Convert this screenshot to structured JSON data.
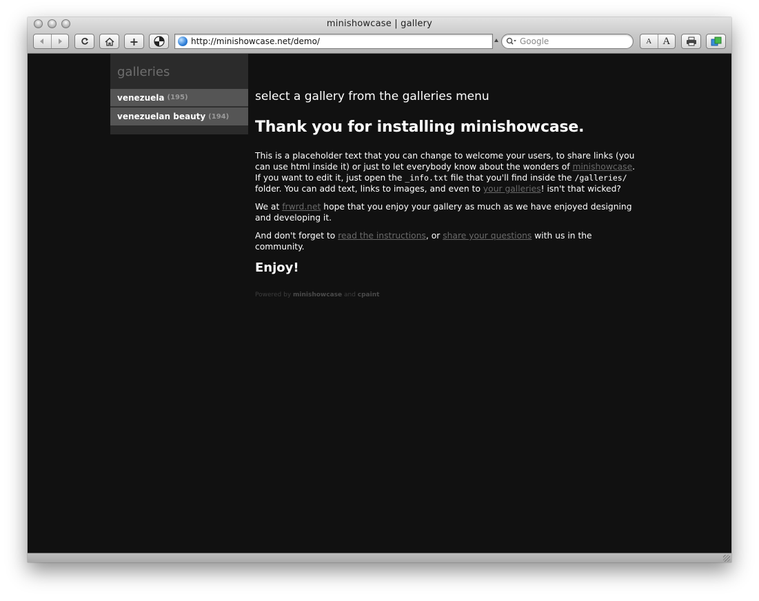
{
  "window": {
    "title": "minishowcase | gallery"
  },
  "toolbar": {
    "back_icon": "back-arrow-icon",
    "forward_icon": "forward-arrow-icon",
    "reload_icon": "reload-icon",
    "home_icon": "home-icon",
    "add_bookmark_label": "+",
    "url": "http://minishowcase.net/demo/",
    "search_placeholder": "Google",
    "text_smaller_label": "A",
    "text_bigger_label": "A"
  },
  "sidebar": {
    "title": "galleries",
    "items": [
      {
        "label": "venezuela",
        "count": "(195)"
      },
      {
        "label": "venezuelan beauty",
        "count": "(194)"
      }
    ]
  },
  "main": {
    "select_message": "select a gallery from the galleries menu",
    "heading": "Thank you for installing minishowcase.",
    "p1": {
      "t1": "This is a placeholder text that you can change to welcome your users, to share links (you can use html inside it) or just to let everybody know about the wonders of ",
      "link1": "minishowcase",
      "t2": ". If you want to edit it, just open the ",
      "code1": "_info.txt",
      "t3": " file that you'll find inside the ",
      "code2": "/galleries/",
      "t4": " folder. You can add text, links to images, and even to ",
      "link2": "your galleries",
      "t5": "! isn't that wicked?"
    },
    "p2": {
      "t1": "We at ",
      "link1": "frwrd.net",
      "t2": " hope that you enjoy your gallery as much as we have enjoyed designing and developing it."
    },
    "p3": {
      "t1": "And don't forget to ",
      "link1": "read the instructions",
      "t2": ", or ",
      "link2": "share your questions",
      "t3": " with us in the community."
    },
    "enjoy": "Enjoy!",
    "footer": {
      "t1": "Powered by ",
      "b1": "minishowcase",
      "t2": " and ",
      "b2": "cpaint"
    }
  }
}
